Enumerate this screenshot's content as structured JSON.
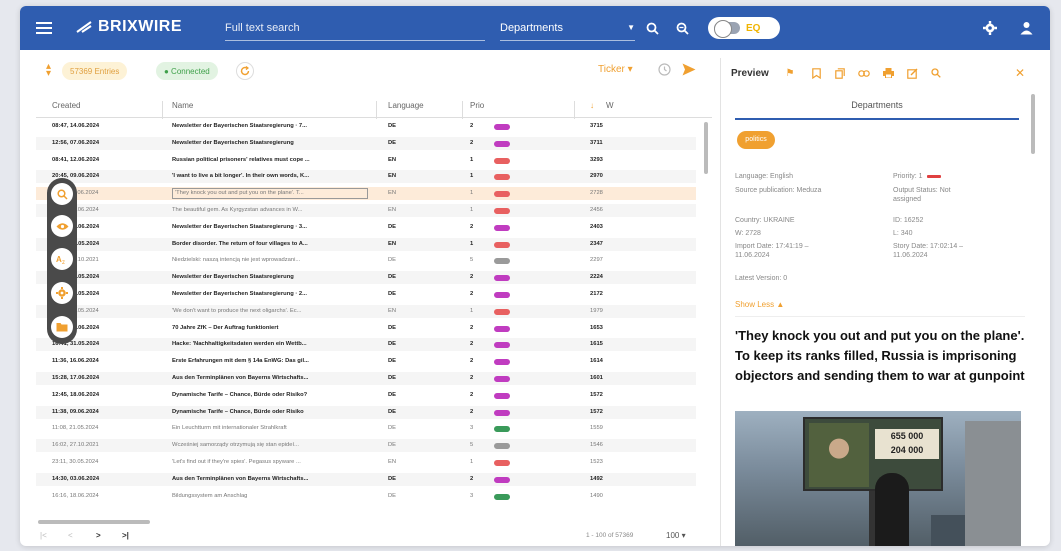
{
  "app": {
    "title": "BRIXWIRE",
    "search_placeholder": "Full text search",
    "departments_label": "Departments",
    "toggle_label": "EQ"
  },
  "toolbar": {
    "entries_badge": "57369 Entries",
    "connected_badge": "● Connected",
    "ticker_label": "Ticker ▾"
  },
  "table": {
    "headers": {
      "created": "Created",
      "name": "Name",
      "language": "Language",
      "prio": "Prio",
      "w": "W",
      "sort_arrow": "↓"
    },
    "rows": [
      {
        "created": "08:47, 14.06.2024",
        "name": "Newsletter der Bayerischen Staatsregierung · 7...",
        "lang": "DE",
        "prio": "2",
        "bar": "#c03cc0",
        "w": "3715",
        "style": "bold"
      },
      {
        "created": "12:56, 07.06.2024",
        "name": "Newsletter der Bayerischen Staatsregierung",
        "lang": "DE",
        "prio": "2",
        "bar": "#c03cc0",
        "w": "3711",
        "style": "bold alt"
      },
      {
        "created": "08:41, 12.06.2024",
        "name": "Russian political prisoners' relatives must cope ...",
        "lang": "EN",
        "prio": "1",
        "bar": "#e86060",
        "w": "3293",
        "style": "bold"
      },
      {
        "created": "20:45, 09.06.2024",
        "name": "'I want to live a bit longer'. In their own words, K...",
        "lang": "EN",
        "prio": "1",
        "bar": "#e86060",
        "w": "2970",
        "style": "bold alt"
      },
      {
        "created": "17:41, 11.06.2024",
        "name": "'They knock you out and put you on the plane'. T...",
        "lang": "EN",
        "prio": "1",
        "bar": "#e86060",
        "w": "2728",
        "style": "muted sel"
      },
      {
        "created": "15:03, 14.06.2024",
        "name": "The beautiful gem. As Kyrgyzstan advances in W...",
        "lang": "EN",
        "prio": "1",
        "bar": "#e86060",
        "w": "2456",
        "style": "muted alt"
      },
      {
        "created": "12:56, 07.06.2024",
        "name": "Newsletter der Bayerischen Staatsregierung · 3...",
        "lang": "DE",
        "prio": "2",
        "bar": "#c03cc0",
        "w": "2403",
        "style": "bold"
      },
      {
        "created": "15:23, 21.05.2024",
        "name": "Border disorder. The return of four villages to A...",
        "lang": "EN",
        "prio": "1",
        "bar": "#e86060",
        "w": "2347",
        "style": "bold alt"
      },
      {
        "created": "16:02, 27.10.2021",
        "name": "Niedzielski: naszą intencją nie jest wprowadzani...",
        "lang": "DE",
        "prio": "5",
        "bar": "#9a9a9a",
        "w": "2297",
        "style": "muted"
      },
      {
        "created": "10:56, 24.05.2024",
        "name": "Newsletter der Bayerischen Staatsregierung",
        "lang": "DE",
        "prio": "2",
        "bar": "#c03cc0",
        "w": "2224",
        "style": "bold alt"
      },
      {
        "created": "08:39, 31.05.2024",
        "name": "Newsletter der Bayerischen Staatsregierung · 2...",
        "lang": "DE",
        "prio": "2",
        "bar": "#c03cc0",
        "w": "2172",
        "style": "bold"
      },
      {
        "created": "17:03, 21.05.2024",
        "name": "'We don't want to produce the next oligarchs'. Ec...",
        "lang": "EN",
        "prio": "1",
        "bar": "#e86060",
        "w": "1979",
        "style": "muted alt"
      },
      {
        "created": "13:31, 03.06.2024",
        "name": "70 Jahre ZfK – Der Auftrag funktioniert",
        "lang": "DE",
        "prio": "2",
        "bar": "#c03cc0",
        "w": "1653",
        "style": "bold"
      },
      {
        "created": "16:41, 31.05.2024",
        "name": "Hacke: 'Nachhaltigkeitsdaten werden ein Wettb...",
        "lang": "DE",
        "prio": "2",
        "bar": "#c03cc0",
        "w": "1615",
        "style": "bold alt"
      },
      {
        "created": "11:36, 16.06.2024",
        "name": "Erste Erfahrungen mit dem § 14a EnWG: Das gil...",
        "lang": "DE",
        "prio": "2",
        "bar": "#c03cc0",
        "w": "1614",
        "style": "bold"
      },
      {
        "created": "15:28, 17.06.2024",
        "name": "Aus den Terminplänen von Bayerns Wirtschafts...",
        "lang": "DE",
        "prio": "2",
        "bar": "#c03cc0",
        "w": "1601",
        "style": "bold alt"
      },
      {
        "created": "12:45, 18.06.2024",
        "name": "Dynamische Tarife – Chance, Bürde oder Risiko?",
        "lang": "DE",
        "prio": "2",
        "bar": "#c03cc0",
        "w": "1572",
        "style": "bold"
      },
      {
        "created": "11:38, 09.06.2024",
        "name": "Dynamische Tarife – Chance, Bürde oder Risiko",
        "lang": "DE",
        "prio": "2",
        "bar": "#c03cc0",
        "w": "1572",
        "style": "bold alt"
      },
      {
        "created": "11:08, 21.05.2024",
        "name": "Ein Leuchtturm mit internationaler Strahlkraft",
        "lang": "DE",
        "prio": "3",
        "bar": "#3a9a5a",
        "w": "1559",
        "style": "muted"
      },
      {
        "created": "16:02, 27.10.2021",
        "name": "Wcześniej samorządy otrzymują się stan epideí...",
        "lang": "DE",
        "prio": "5",
        "bar": "#9a9a9a",
        "w": "1546",
        "style": "muted alt"
      },
      {
        "created": "23:11, 30.05.2024",
        "name": "'Let's find out if they're spies'. Pegasus spyware ...",
        "lang": "EN",
        "prio": "1",
        "bar": "#e86060",
        "w": "1523",
        "style": "muted"
      },
      {
        "created": "14:30, 03.06.2024",
        "name": "Aus den Terminplänen von Bayerns Wirtschafts...",
        "lang": "DE",
        "prio": "2",
        "bar": "#c03cc0",
        "w": "1492",
        "style": "bold alt"
      },
      {
        "created": "16:16, 18.06.2024",
        "name": "Bildungssystem am Anschlag",
        "lang": "DE",
        "prio": "3",
        "bar": "#3a9a5a",
        "w": "1490",
        "style": "muted"
      }
    ]
  },
  "footer": {
    "first": "|<",
    "prev": "<",
    "next": ">",
    "last": ">|",
    "range": "1 - 100 of 57369",
    "page_size": "100 ▾"
  },
  "preview": {
    "title": "Preview",
    "departments": "Departments",
    "tag": "politics",
    "language": "Language: English",
    "priority": "Priority: 1",
    "source": "Source publication: Meduza",
    "output_status": "Output Status: Not assigned",
    "country": "Country: UKRAINE",
    "id": "ID: 16252",
    "w": "W: 2728",
    "l": "L: 340",
    "import_date": "Import Date: 17:41:19 – 11.06.2024",
    "story_date": "Story Date: 17:02:14 – 11.06.2024",
    "latest_version": "Latest Version: 0",
    "show_less": "Show Less ▲",
    "headline": "'They knock you out and put you on the plane'. To keep its ranks filled, Russia is imprisoning objectors and sending them to war at gunpoint",
    "billboard_line1": "655 000",
    "billboard_line2": "204 000"
  },
  "colors": {
    "topbar": "#2f5db0",
    "accent": "#f0a030",
    "selected_row": "#fdebd9"
  }
}
